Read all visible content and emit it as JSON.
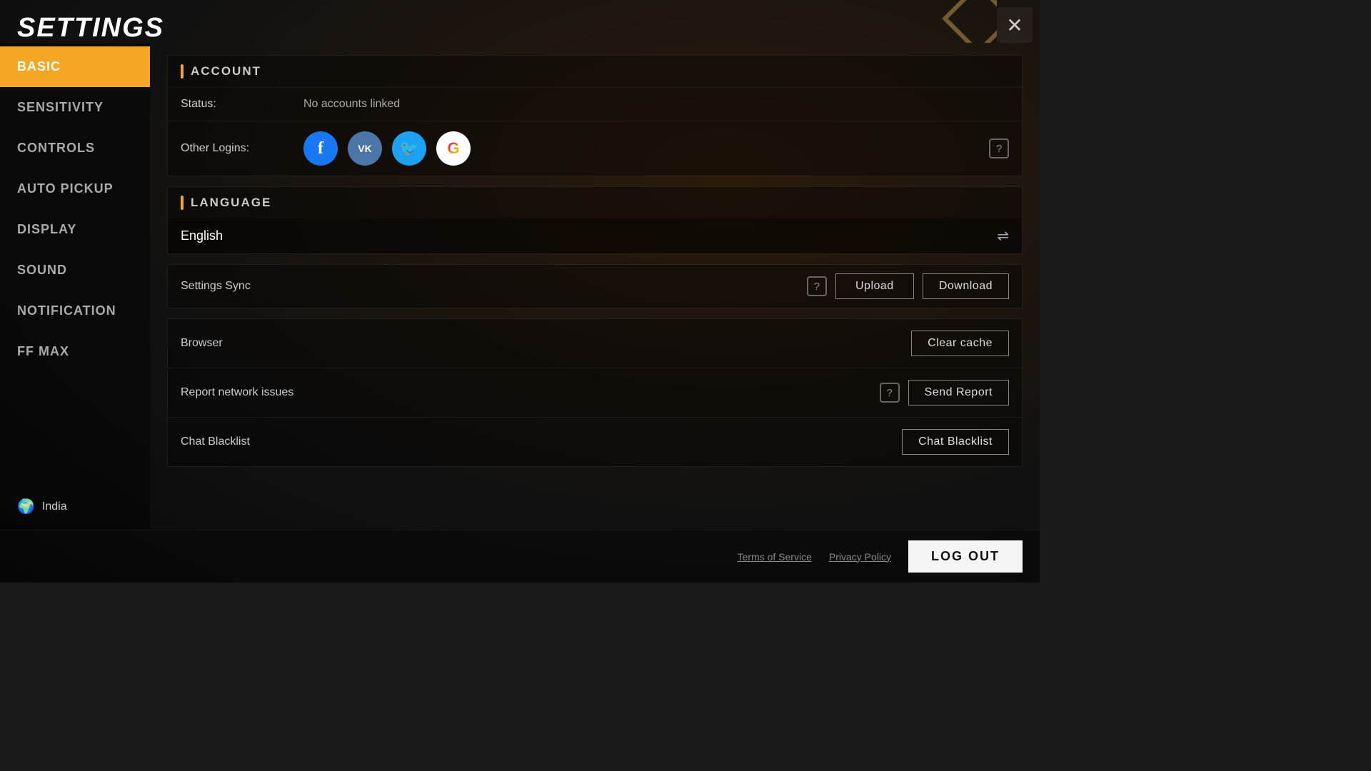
{
  "app": {
    "title": "SETTINGS",
    "close_label": "✕"
  },
  "sidebar": {
    "items": [
      {
        "id": "basic",
        "label": "BASIC",
        "active": true
      },
      {
        "id": "sensitivity",
        "label": "SENSITIVITY",
        "active": false
      },
      {
        "id": "controls",
        "label": "CONTROLS",
        "active": false
      },
      {
        "id": "auto-pickup",
        "label": "AUTO PICKUP",
        "active": false
      },
      {
        "id": "display",
        "label": "DISPLAY",
        "active": false
      },
      {
        "id": "sound",
        "label": "SOUND",
        "active": false
      },
      {
        "id": "notification",
        "label": "NOTIFICATION",
        "active": false
      },
      {
        "id": "ff-max",
        "label": "FF MAX",
        "active": false
      }
    ],
    "region": "India"
  },
  "content": {
    "account_section": {
      "title": "ACCOUNT",
      "status_label": "Status:",
      "status_value": "No accounts linked",
      "other_logins_label": "Other Logins:"
    },
    "language_section": {
      "title": "LANGUAGE",
      "current_language": "English"
    },
    "settings_sync": {
      "label": "Settings Sync",
      "upload_btn": "Upload",
      "download_btn": "Download"
    },
    "browser": {
      "label": "Browser",
      "clear_cache_btn": "Clear cache"
    },
    "report": {
      "label": "Report network issues",
      "send_report_btn": "Send Report"
    },
    "blacklist": {
      "label": "Chat Blacklist",
      "chat_blacklist_btn": "Chat Blacklist"
    }
  },
  "footer": {
    "terms_label": "Terms of Service",
    "privacy_label": "Privacy Policy",
    "logout_btn": "LOG OUT"
  },
  "social_icons": {
    "facebook": "f",
    "vk": "vk",
    "twitter": "🐦",
    "google": "G"
  }
}
